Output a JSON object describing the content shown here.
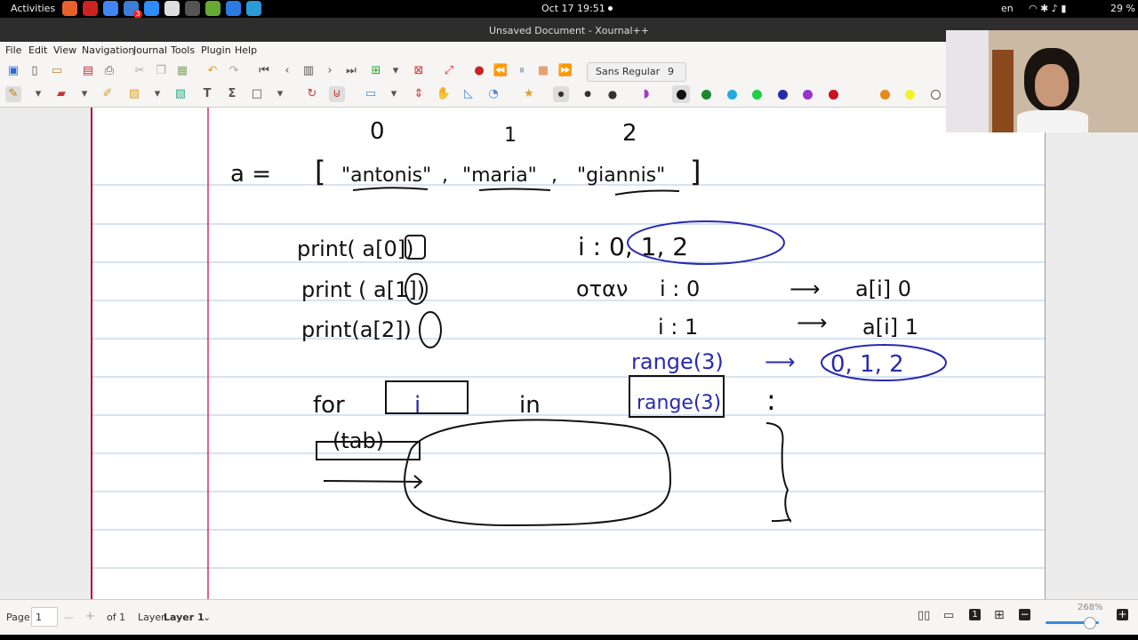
{
  "system": {
    "activities": "Activities",
    "clock": "Oct 17  19:51",
    "language": "en",
    "battery": "29 %",
    "notification_count": "3"
  },
  "window": {
    "title": "Unsaved Document - Xournal++"
  },
  "menu": [
    "File",
    "Edit",
    "View",
    "Navigation",
    "Journal",
    "Tools",
    "Plugin",
    "Help"
  ],
  "toolbar": {
    "font_name": "Sans Regular",
    "font_size": "9"
  },
  "palette": [
    "#111111",
    "#1a8a2e",
    "#22aadd",
    "#22cc44",
    "#2a2ab0",
    "#9933cc",
    "#cc1122",
    "#e58a1a",
    "#f2f22a",
    "#ffffff"
  ],
  "accent": "#b0003a",
  "notes": {
    "indices": [
      "0",
      "1",
      "2"
    ],
    "assign": "a =",
    "list_items": [
      "\"antonis\"",
      "\"maria\"",
      "\"giannis\""
    ],
    "prints": [
      "print( a[0])",
      "print ( a[1])",
      "print(a[2])"
    ],
    "i_values": "i : 0, 1, 2",
    "otan": "οταν",
    "step0": "i : 0",
    "step0_result": "a[i] 0",
    "step1": "i : 1",
    "step1_result": "a[i] 1",
    "range_expr": "range(3)",
    "range_values": "0, 1, 2",
    "for_kw": "for",
    "for_var": "i",
    "in_kw": "in",
    "for_range": "range(3)",
    "colon": ":",
    "tab_label": "(tab)"
  },
  "status": {
    "page_label": "Page",
    "page_value": "1",
    "of_pages": "of 1",
    "layer_label": "Layer",
    "layer_value": "Layer 1",
    "zoom": "268%"
  }
}
